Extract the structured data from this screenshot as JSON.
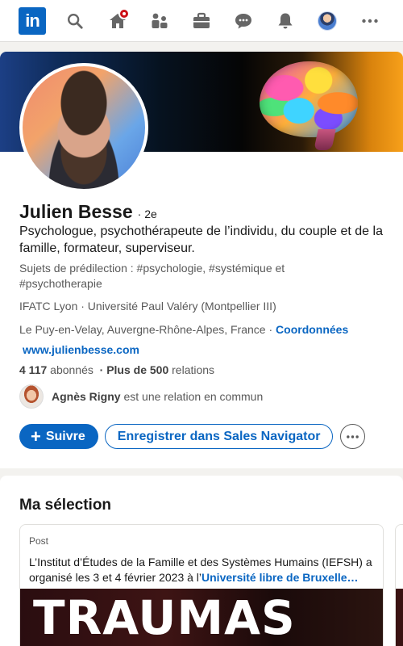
{
  "nav": {
    "logo_text": "in",
    "icons": [
      "search-icon",
      "home-icon",
      "network-icon",
      "jobs-icon",
      "messaging-icon",
      "notifications-icon",
      "me-avatar",
      "more-icon"
    ],
    "accent": "#0a66c2",
    "notification_color": "#cc1016"
  },
  "profile": {
    "name": "Julien Besse",
    "degree": "· 2e",
    "headline": "Psychologue, psychothérapeute de l’individu, du couple et de la famille, formateur, superviseur.",
    "topics": "Sujets de prédilection : #psychologie, #systémique et #psychotherapie",
    "education": "IFATC Lyon · Université Paul Valéry (Montpellier III)",
    "location": "Le Puy-en-Velay, Auvergne-Rhône-Alpes, France ·",
    "contact_link": "Coordonnées",
    "website": "www.julienbesse.com",
    "followers_count": "4 117",
    "followers_label": "abonnés",
    "relations_prefix": "· Plus de 500",
    "relations_label": "relations",
    "mutual_name": "Agnès Rigny",
    "mutual_text": "est une relation en commun",
    "follow_icon": "+",
    "follow_label": "Suivre",
    "sales_nav_label": "Enregistrer dans Sales Navigator",
    "more_icon": "···"
  },
  "featured": {
    "title": "Ma sélection",
    "post_label": "Post",
    "post_text": "L’Institut d’Études de la Famille et des Systèmes Humains (IEFSH) a organisé les 3 et 4 février 2023 à l’",
    "post_link": "Université libre de Bruxelle…",
    "image_text": "TRAUMAS"
  }
}
